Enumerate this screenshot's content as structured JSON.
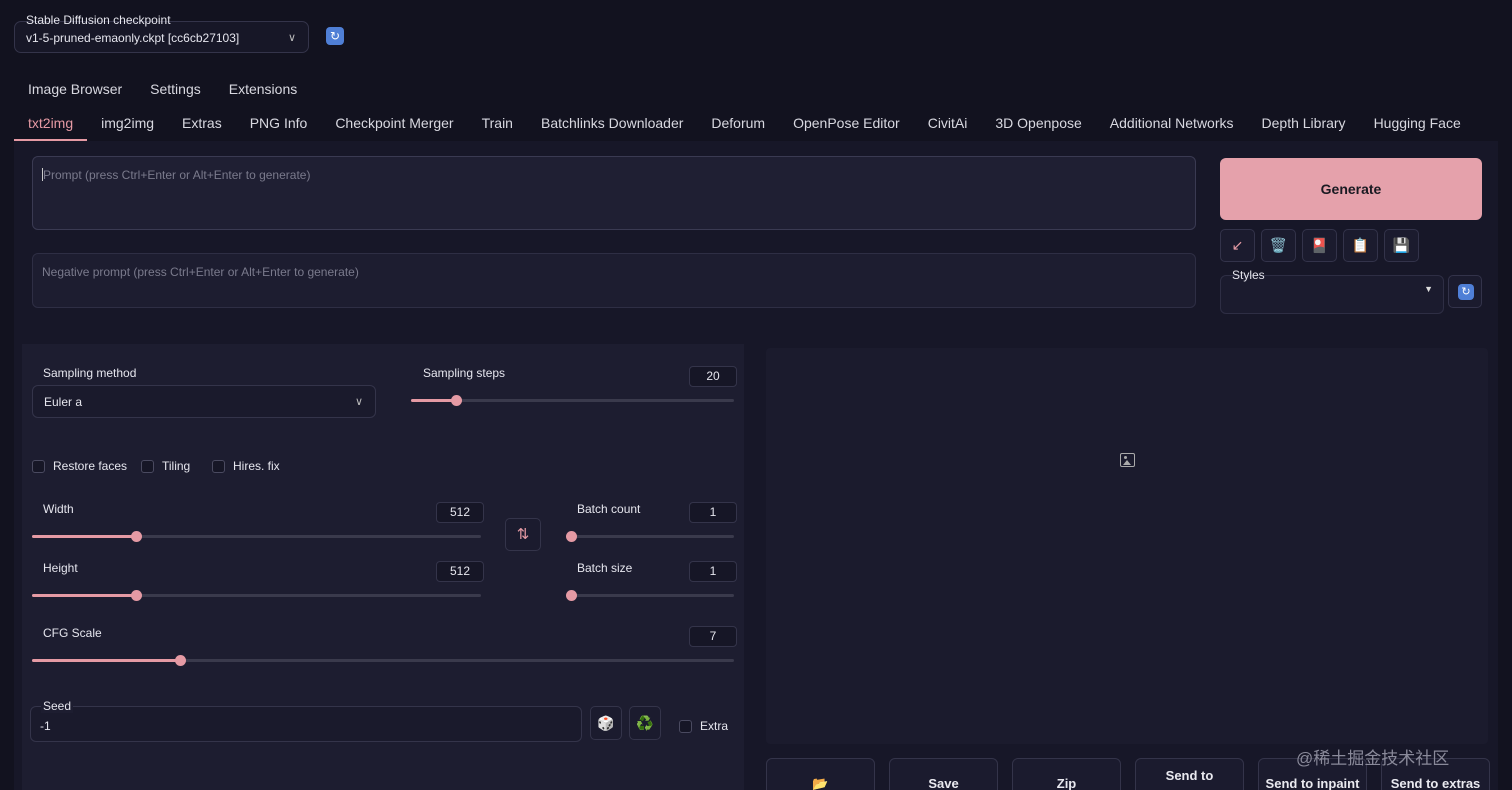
{
  "checkpoint": {
    "label": "Stable Diffusion checkpoint",
    "value": "v1-5-pruned-emaonly.ckpt [cc6cb27103]",
    "refresh_icon": "refresh-icon"
  },
  "tabs_top": [
    "Image Browser",
    "Settings",
    "Extensions"
  ],
  "tabs_main": [
    "txt2img",
    "img2img",
    "Extras",
    "PNG Info",
    "Checkpoint Merger",
    "Train",
    "Batchlinks Downloader",
    "Deforum",
    "OpenPose Editor",
    "CivitAi",
    "3D Openpose",
    "Additional Networks",
    "Depth Library",
    "Hugging Face"
  ],
  "prompt": {
    "placeholder": "Prompt (press Ctrl+Enter or Alt+Enter to generate)",
    "negative_placeholder": "Negative prompt (press Ctrl+Enter or Alt+Enter to generate)"
  },
  "actions": {
    "generate_label": "Generate",
    "tools": [
      {
        "icon": "↙",
        "name": "read-params-icon"
      },
      {
        "icon": "🗑️",
        "name": "trash-icon"
      },
      {
        "icon": "🎴",
        "name": "extra-networks-icon"
      },
      {
        "icon": "📋",
        "name": "clipboard-icon"
      },
      {
        "icon": "💾",
        "name": "save-style-icon"
      }
    ],
    "styles_label": "Styles"
  },
  "sampling": {
    "method_label": "Sampling method",
    "method_value": "Euler a",
    "steps_label": "Sampling steps",
    "steps_value": "20"
  },
  "options": {
    "restore_faces": "Restore faces",
    "tiling": "Tiling",
    "hires_fix": "Hires. fix"
  },
  "size": {
    "width_label": "Width",
    "width_value": "512",
    "height_label": "Height",
    "height_value": "512",
    "batch_count_label": "Batch count",
    "batch_count_value": "1",
    "batch_size_label": "Batch size",
    "batch_size_value": "1",
    "swap_icon": "⇅"
  },
  "cfg": {
    "label": "CFG Scale",
    "value": "7"
  },
  "seed": {
    "label": "Seed",
    "value": "-1",
    "dice_icon": "🎲",
    "recycle_icon": "♻️",
    "extra_label": "Extra"
  },
  "output": {
    "buttons": [
      "📂",
      "Save",
      "Zip",
      "Send to",
      "Send to inpaint",
      "Send to extras"
    ]
  },
  "watermark": "@稀土掘金技术社区",
  "colors": {
    "accent": "#e59aa4",
    "background": "#12121f",
    "panel": "#1d1d30"
  }
}
